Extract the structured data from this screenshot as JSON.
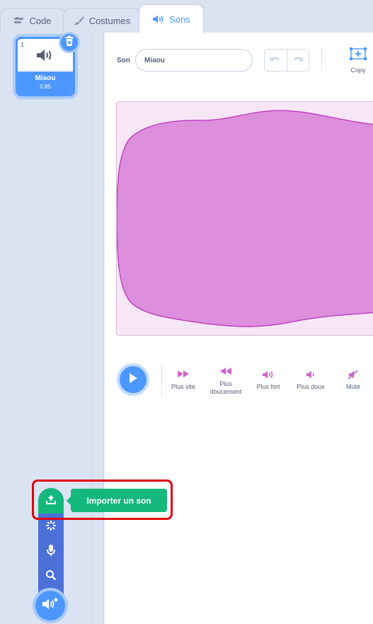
{
  "tabs": [
    {
      "label": "Code",
      "icon": "code-icon"
    },
    {
      "label": "Costumes",
      "icon": "brush-icon"
    },
    {
      "label": "Sons",
      "icon": "speaker-icon",
      "active": true
    }
  ],
  "sound_list": [
    {
      "index": "1",
      "name": "Miaou",
      "duration": "0.85",
      "icon": "speaker-icon",
      "selected": true
    }
  ],
  "editor": {
    "name_label": "Son",
    "name_value": "Miaou",
    "copy_label": "Copy"
  },
  "effects": [
    {
      "label": "Plus vite",
      "icon": "fast-forward-icon"
    },
    {
      "label": "Plus\ndoucement",
      "icon": "rewind-icon"
    },
    {
      "label": "Plus fort",
      "icon": "volume-up-icon"
    },
    {
      "label": "Plus doux",
      "icon": "volume-down-icon"
    },
    {
      "label": "Mute",
      "icon": "mute-icon"
    }
  ],
  "add_menu": {
    "tooltip": "Importer un son",
    "items": [
      "upload-icon",
      "surprise-icon",
      "microphone-icon",
      "search-icon"
    ]
  },
  "colors": {
    "accent": "#4c97ff",
    "waveform": "#cf63cf",
    "upload_green": "#14b87c",
    "highlight": "#e0000b"
  }
}
